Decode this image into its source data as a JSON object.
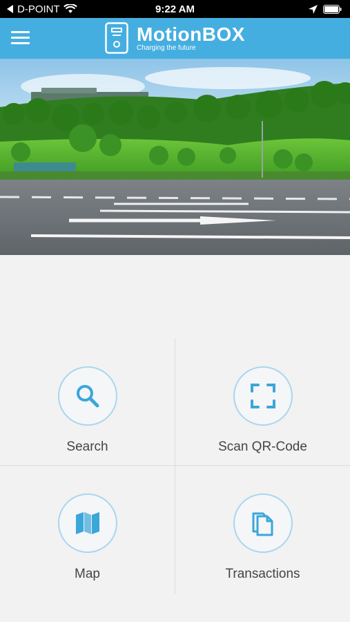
{
  "status_bar": {
    "carrier": "D-POINT",
    "time": "9:22 AM"
  },
  "header": {
    "app_name": "MotionBOX",
    "tagline": "Charging the future",
    "brand_color": "#45aee0"
  },
  "tiles": [
    {
      "label": "Search",
      "icon": "search-icon"
    },
    {
      "label": "Scan QR-Code",
      "icon": "qr-scan-icon"
    },
    {
      "label": "Map",
      "icon": "map-icon"
    },
    {
      "label": "Transactions",
      "icon": "documents-icon"
    }
  ],
  "colors": {
    "accent": "#3ba6d9",
    "ring": "#a9d6ee",
    "background": "#f2f2f2"
  }
}
